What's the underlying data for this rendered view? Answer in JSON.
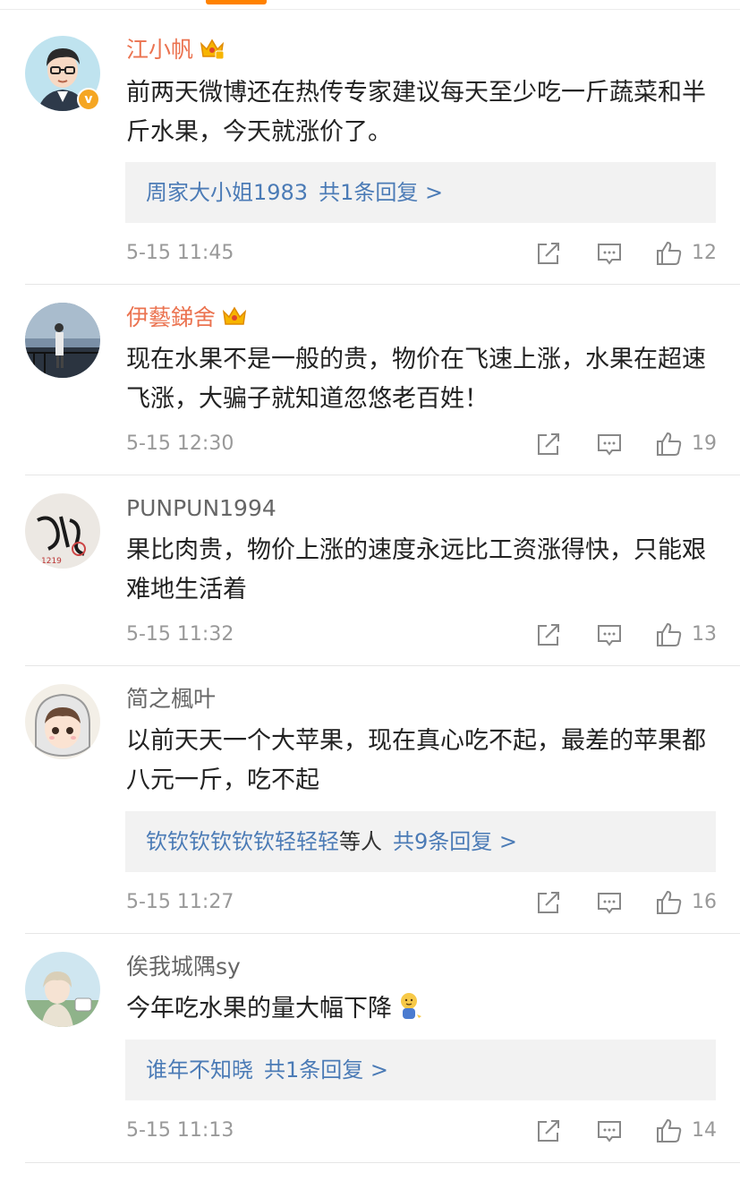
{
  "colors": {
    "accent": "#ff8200",
    "username_highlight": "#eb7350",
    "reply_link": "#4b7bb6",
    "verified_badge": "#f5a623"
  },
  "comments": [
    {
      "username": "江小帆",
      "text": "前两天微博还在热传专家建议每天至少吃一斤蔬菜和半斤水果，今天就涨价了。",
      "reply": {
        "names": "周家大小姐1983",
        "suffix": "",
        "count": "共1条回复 >"
      },
      "time": "5-15 11:45",
      "likes": "12"
    },
    {
      "username": "伊藝銻舍",
      "text": "现在水果不是一般的贵，物价在飞速上涨，水果在超速飞涨，大骗子就知道忽悠老百姓！",
      "time": "5-15 12:30",
      "likes": "19"
    },
    {
      "username": "PUNPUN1994",
      "text": "果比肉贵，物价上涨的速度永远比工资涨得快，只能艰难地生活着",
      "time": "5-15 11:32",
      "likes": "13"
    },
    {
      "username": "简之楓叶",
      "text": "以前天天一个大苹果，现在真心吃不起，最差的苹果都八元一斤，吃不起",
      "reply": {
        "names": "钦钦钦钦钦钦轻轻轻",
        "suffix": "等人",
        "count": "共9条回复 >"
      },
      "time": "5-15 11:27",
      "likes": "16"
    },
    {
      "username": "俟我城隅sy",
      "text": "今年吃水果的量大幅下降",
      "reply": {
        "names": "谁年不知晓",
        "suffix": "",
        "count": "共1条回复 >"
      },
      "time": "5-15 11:13",
      "likes": "14"
    }
  ]
}
